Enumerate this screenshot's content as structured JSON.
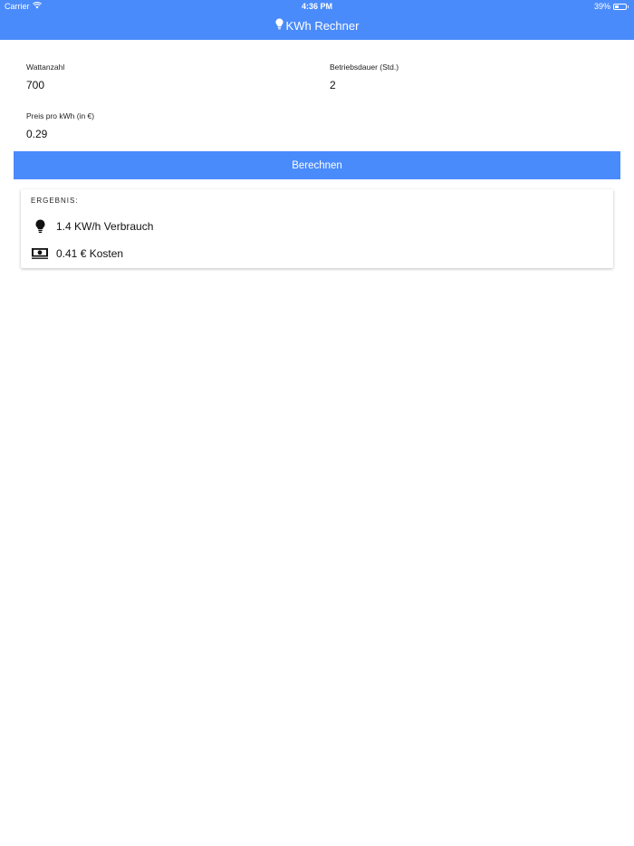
{
  "status_bar": {
    "carrier": "Carrier",
    "time": "4:36 PM",
    "battery_percent": "39%",
    "battery_level": 0.39
  },
  "header": {
    "title": "KWh Rechner",
    "title_icon": "lightbulb-icon"
  },
  "form": {
    "watt": {
      "label": "Wattanzahl",
      "value": "700"
    },
    "duration": {
      "label": "Betriebsdauer (Std.)",
      "value": "2"
    },
    "price": {
      "label": "Preis pro kWh (in €)",
      "value": "0.29"
    }
  },
  "calculate_button": {
    "label": "Berechnen"
  },
  "result": {
    "title": "ERGEBNIS:",
    "consumption": {
      "text": "1.4 KW/h Verbrauch",
      "icon": "lightbulb-icon"
    },
    "cost": {
      "text": "0.41 € Kosten",
      "icon": "money-icon"
    }
  },
  "colors": {
    "accent": "#4a8bfc",
    "background": "#ffffff"
  }
}
